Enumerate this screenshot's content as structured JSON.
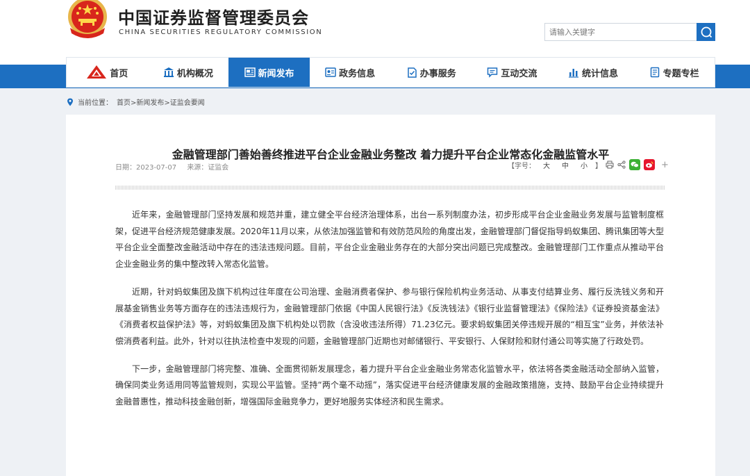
{
  "header": {
    "site_title": "中国证券监督管理委员会",
    "site_subtitle": "CHINA SECURITIES REGULATORY COMMISSION",
    "emblem_icon": "national-emblem-icon",
    "search_placeholder": "请输入关键字",
    "search_icon": "search-icon",
    "brand_color": "#1d6fc1"
  },
  "nav": {
    "items": [
      {
        "label": "首页",
        "icon": "home-logo-icon"
      },
      {
        "label": "机构概况",
        "icon": "building-icon"
      },
      {
        "label": "新闻发布",
        "icon": "news-icon",
        "active": true
      },
      {
        "label": "政务信息",
        "icon": "gov-info-icon"
      },
      {
        "label": "办事服务",
        "icon": "service-icon"
      },
      {
        "label": "互动交流",
        "icon": "chat-icon"
      },
      {
        "label": "统计信息",
        "icon": "stats-icon"
      },
      {
        "label": "专题专栏",
        "icon": "topic-icon"
      }
    ]
  },
  "breadcrumb": {
    "prefix": "当前位置：",
    "path": "首页>新闻发布>证监会要闻"
  },
  "article": {
    "title": "金融管理部门善始善终推进平台企业金融业务整改 着力提升平台企业常态化金融监管水平",
    "date": "日期：2023-07-07",
    "source": "来源：证监会",
    "font_size_label": "【字号：",
    "size_large": "大",
    "size_medium": "中",
    "size_small": "小",
    "size_close": "】",
    "paragraphs": [
      "近年来，金融管理部门坚持发展和规范并重，建立健全平台经济治理体系，出台一系列制度办法，初步形成平台企业金融业务发展与监管制度框架，促进平台经济规范健康发展。2020年11月以来，从依法加强监管和有效防范风险的角度出发，金融管理部门督促指导蚂蚁集团、腾讯集团等大型平台企业全面整改金融活动中存在的违法违规问题。目前，平台企业金融业务存在的大部分突出问题已完成整改。金融管理部门工作重点从推动平台企业金融业务的集中整改转入常态化监管。",
      "近期，针对蚂蚁集团及旗下机构过往年度在公司治理、金融消费者保护、参与银行保险机构业务活动、从事支付结算业务、履行反洗钱义务和开展基金销售业务等方面存在的违法违规行为，金融管理部门依据《中国人民银行法》《反洗钱法》《银行业监督管理法》《保险法》《证券投资基金法》《消费者权益保护法》等，对蚂蚁集团及旗下机构处以罚款（含没收违法所得）71.23亿元。要求蚂蚁集团关停违规开展的“相互宝”业务，并依法补偿消费者利益。此外，针对以往执法检查中发现的问题，金融管理部门近期也对邮储银行、平安银行、人保财险和财付通公司等实施了行政处罚。",
      "下一步，金融管理部门将完整、准确、全面贯彻新发展理念，着力提升平台企业金融业务常态化监管水平，依法将各类金融活动全部纳入监管，确保同类业务适用同等监管规则，实现公平监管。坚持“两个毫不动摇”，落实促进平台经济健康发展的金融政策措施，支持、鼓励平台企业持续提升金融普惠性，推动科技金融创新，增强国际金融竞争力，更好地服务实体经济和民生需求。"
    ]
  }
}
